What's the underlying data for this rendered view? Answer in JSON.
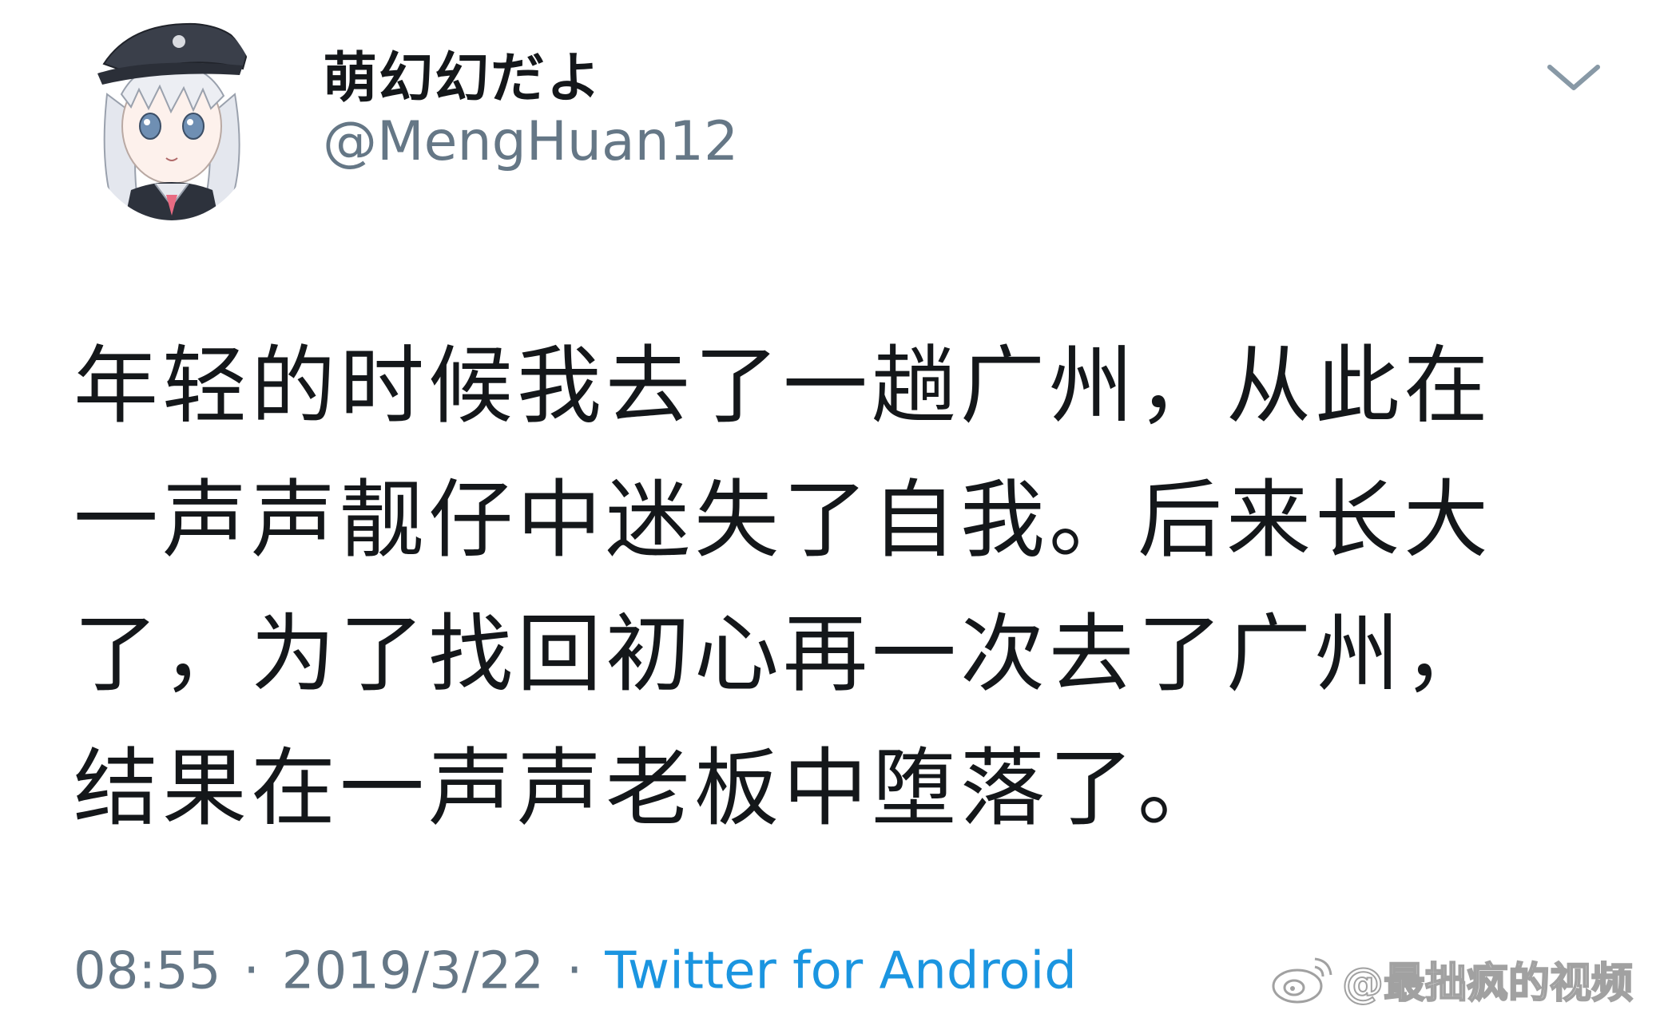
{
  "author": {
    "display_name": "萌幻幻だよ",
    "handle": "@MengHuan12",
    "avatar_icon": "anime-avatar"
  },
  "menu_icon": "chevron-down-icon",
  "tweet": {
    "lines": [
      "年轻的时候我去了一趟广州，从此在",
      "一声声靓仔中迷失了自我。后来长大",
      "了，为了找回初心再一次去了广州，",
      "结果在一声声老板中堕落了。"
    ]
  },
  "meta": {
    "time": "08:55",
    "separator": "·",
    "date": "2019/3/22",
    "source": "Twitter for Android"
  },
  "watermark": {
    "text": "@最拙疯的视频",
    "logo_icon": "weibo-logo"
  },
  "colors": {
    "text": "#14171a",
    "secondary": "#657786",
    "link": "#1b95e0",
    "background": "#ffffff"
  }
}
